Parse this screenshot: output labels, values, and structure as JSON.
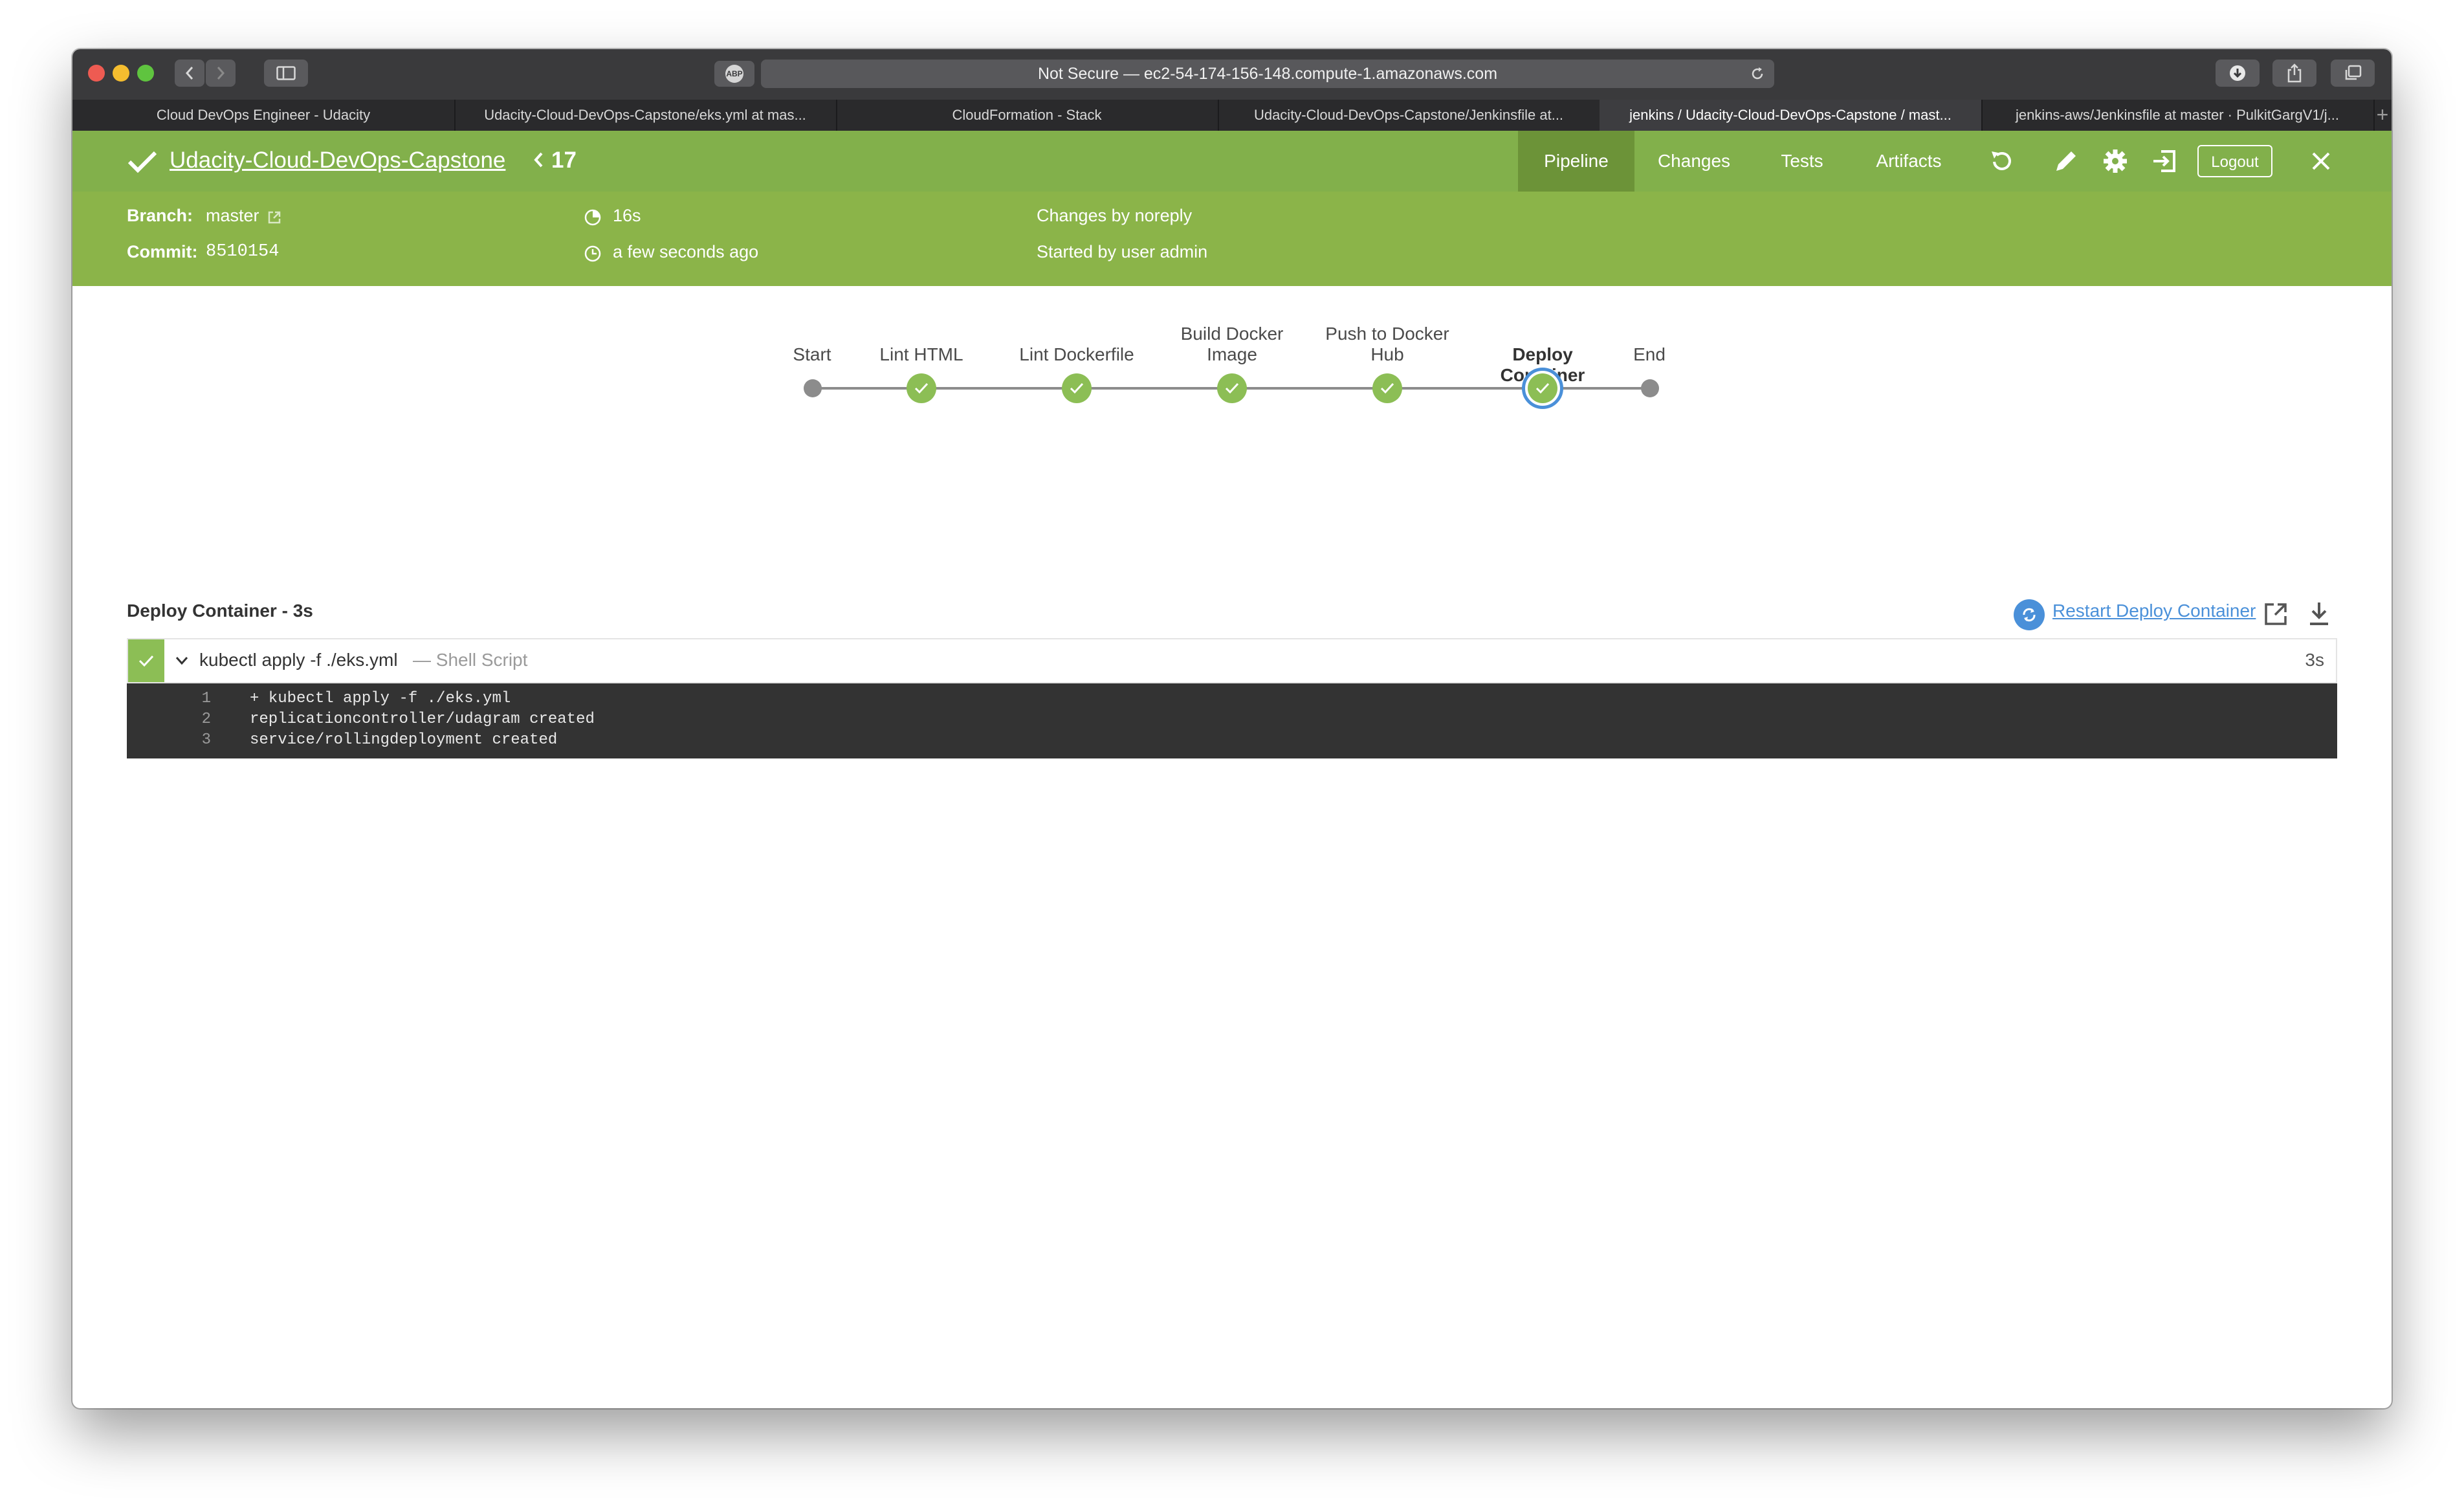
{
  "browser": {
    "address": "Not Secure — ec2-54-174-156-148.compute-1.amazonaws.com",
    "abp_label": "ABP",
    "tabs": [
      "Cloud DevOps Engineer - Udacity",
      "Udacity-Cloud-DevOps-Capstone/eks.yml at mas...",
      "CloudFormation - Stack",
      "Udacity-Cloud-DevOps-Capstone/Jenkinsfile at...",
      "jenkins / Udacity-Cloud-DevOps-Capstone / mast...",
      "jenkins-aws/Jenkinsfile at master · PulkitGargV1/j..."
    ],
    "new_tab": "+"
  },
  "header": {
    "project": "Udacity-Cloud-DevOps-Capstone",
    "run_number": "17",
    "nav": [
      "Pipeline",
      "Changes",
      "Tests",
      "Artifacts"
    ],
    "active_nav": "Pipeline",
    "logout": "Logout"
  },
  "summary": {
    "branch_label": "Branch:",
    "branch": "master",
    "commit_label": "Commit:",
    "commit": "8510154",
    "duration": "16s",
    "started": "a few seconds ago",
    "changes": "Changes by noreply",
    "started_by": "Started by user admin"
  },
  "pipeline": {
    "stages": [
      {
        "label": "Start",
        "status": "start"
      },
      {
        "label": "Lint HTML",
        "status": "success"
      },
      {
        "label": "Lint Dockerfile",
        "status": "success"
      },
      {
        "label": "Build Docker\nImage",
        "status": "success"
      },
      {
        "label": "Push to Docker\nHub",
        "status": "success"
      },
      {
        "label": "Deploy Container",
        "status": "success",
        "selected": true
      },
      {
        "label": "End",
        "status": "end"
      }
    ]
  },
  "step": {
    "title": "Deploy Container - 3s",
    "restart": "Restart Deploy Container",
    "name": "kubectl apply -f ./eks.yml",
    "type": "— Shell Script",
    "duration": "3s",
    "log": [
      {
        "n": "1",
        "text": "+ kubectl apply -f ./eks.yml"
      },
      {
        "n": "2",
        "text": "replicationcontroller/udagram created"
      },
      {
        "n": "3",
        "text": "service/rollingdeployment created"
      }
    ]
  },
  "colors": {
    "header_green": "#82b04b",
    "subheader_green": "#8bb449",
    "success": "#8cbe55",
    "selected_ring": "#4a90d9"
  }
}
